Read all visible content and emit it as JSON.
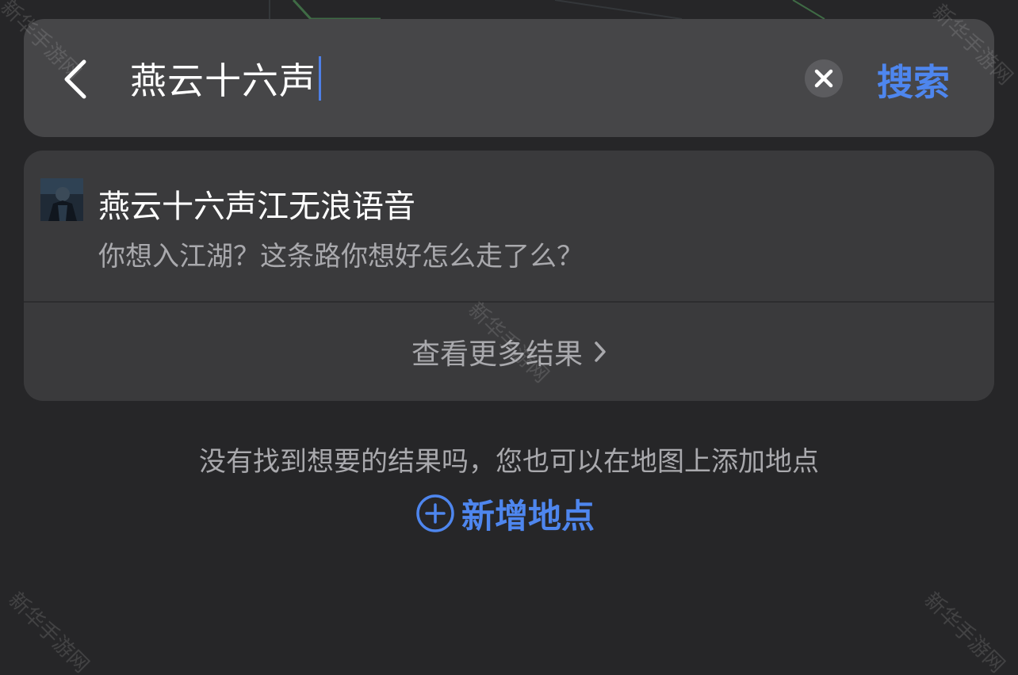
{
  "search": {
    "query": "燕云十六声",
    "submit_label": "搜索"
  },
  "results": [
    {
      "title": "燕云十六声江无浪语音",
      "subtitle": "你想入江湖？这条路你想好怎么走了么？"
    }
  ],
  "more_results": {
    "label": "查看更多结果"
  },
  "hint": {
    "text": "没有找到想要的结果吗，您也可以在地图上添加地点"
  },
  "add_place": {
    "label": "新增地点"
  },
  "watermark": {
    "text": "新华手游网"
  },
  "colors": {
    "background": "#262628",
    "search_bar": "#464648",
    "card": "#3a3a3c",
    "accent": "#4e86ee",
    "primary_text": "#ffffff",
    "secondary_text": "#a9a9ad"
  }
}
